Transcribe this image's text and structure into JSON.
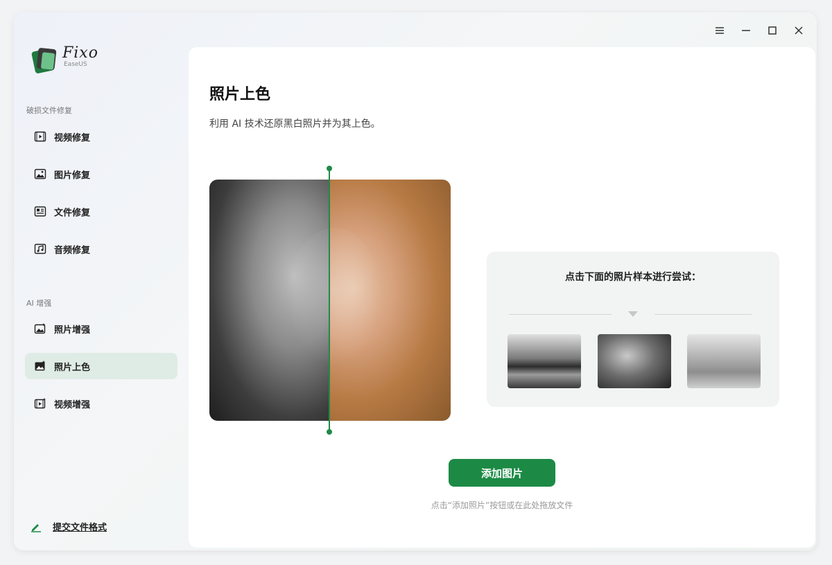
{
  "window": {
    "controls": [
      "menu-icon",
      "minimize-icon",
      "maximize-icon",
      "close-icon"
    ]
  },
  "app": {
    "name": "Fixo",
    "brand": "EaseUS"
  },
  "sidebar": {
    "section1_title": "破损文件修复",
    "section1_items": [
      {
        "label": "视频修复",
        "icon": "video-icon"
      },
      {
        "label": "图片修复",
        "icon": "image-icon"
      },
      {
        "label": "文件修复",
        "icon": "document-icon"
      },
      {
        "label": "音频修复",
        "icon": "audio-icon"
      }
    ],
    "section2_title": "AI 增强",
    "section2_items": [
      {
        "label": "照片增强",
        "icon": "photo-enhance-icon"
      },
      {
        "label": "照片上色",
        "icon": "photo-colorize-icon",
        "active": true
      },
      {
        "label": "视频增强",
        "icon": "video-enhance-icon"
      }
    ],
    "submit_format": "提交文件格式"
  },
  "main": {
    "title": "照片上色",
    "subtitle": "利用 AI 技术还原黑白照片并为其上色。",
    "samples": {
      "title": "点击下面的照片样本进行尝试：",
      "items": [
        "sample-landscape",
        "sample-portrait",
        "sample-family"
      ]
    },
    "add_button": "添加图片",
    "drop_hint": "点击“添加照片”按钮或在此处拖放文件"
  },
  "colors": {
    "accent": "#1c8a45",
    "active_bg": "#dfece6"
  }
}
